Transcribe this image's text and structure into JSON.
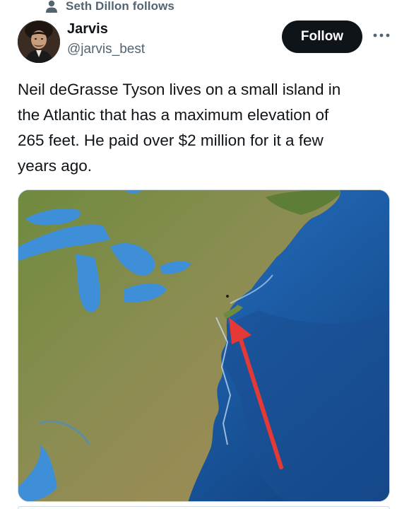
{
  "social_context": {
    "icon": "person-icon",
    "text": "Seth Dillon follows"
  },
  "author": {
    "display_name": "Jarvis",
    "handle": "@jarvis_best",
    "avatar_icon": "avatar-portrait"
  },
  "actions": {
    "follow_label": "Follow",
    "more_icon": "more-horizontal-icon"
  },
  "tweet": {
    "text": "Neil deGrasse Tyson lives on a small island in\nthe Atlantic that has a maximum elevation of\n265 feet.  He paid over $2 million for it a few\nyears ago."
  },
  "media": {
    "description_icon": "map-image",
    "arrow_color": "#e53935"
  },
  "colors": {
    "text_primary": "#0f1419",
    "text_secondary": "#536471",
    "follow_bg": "#0f1419",
    "follow_text": "#ffffff",
    "border": "#cfd9de"
  }
}
